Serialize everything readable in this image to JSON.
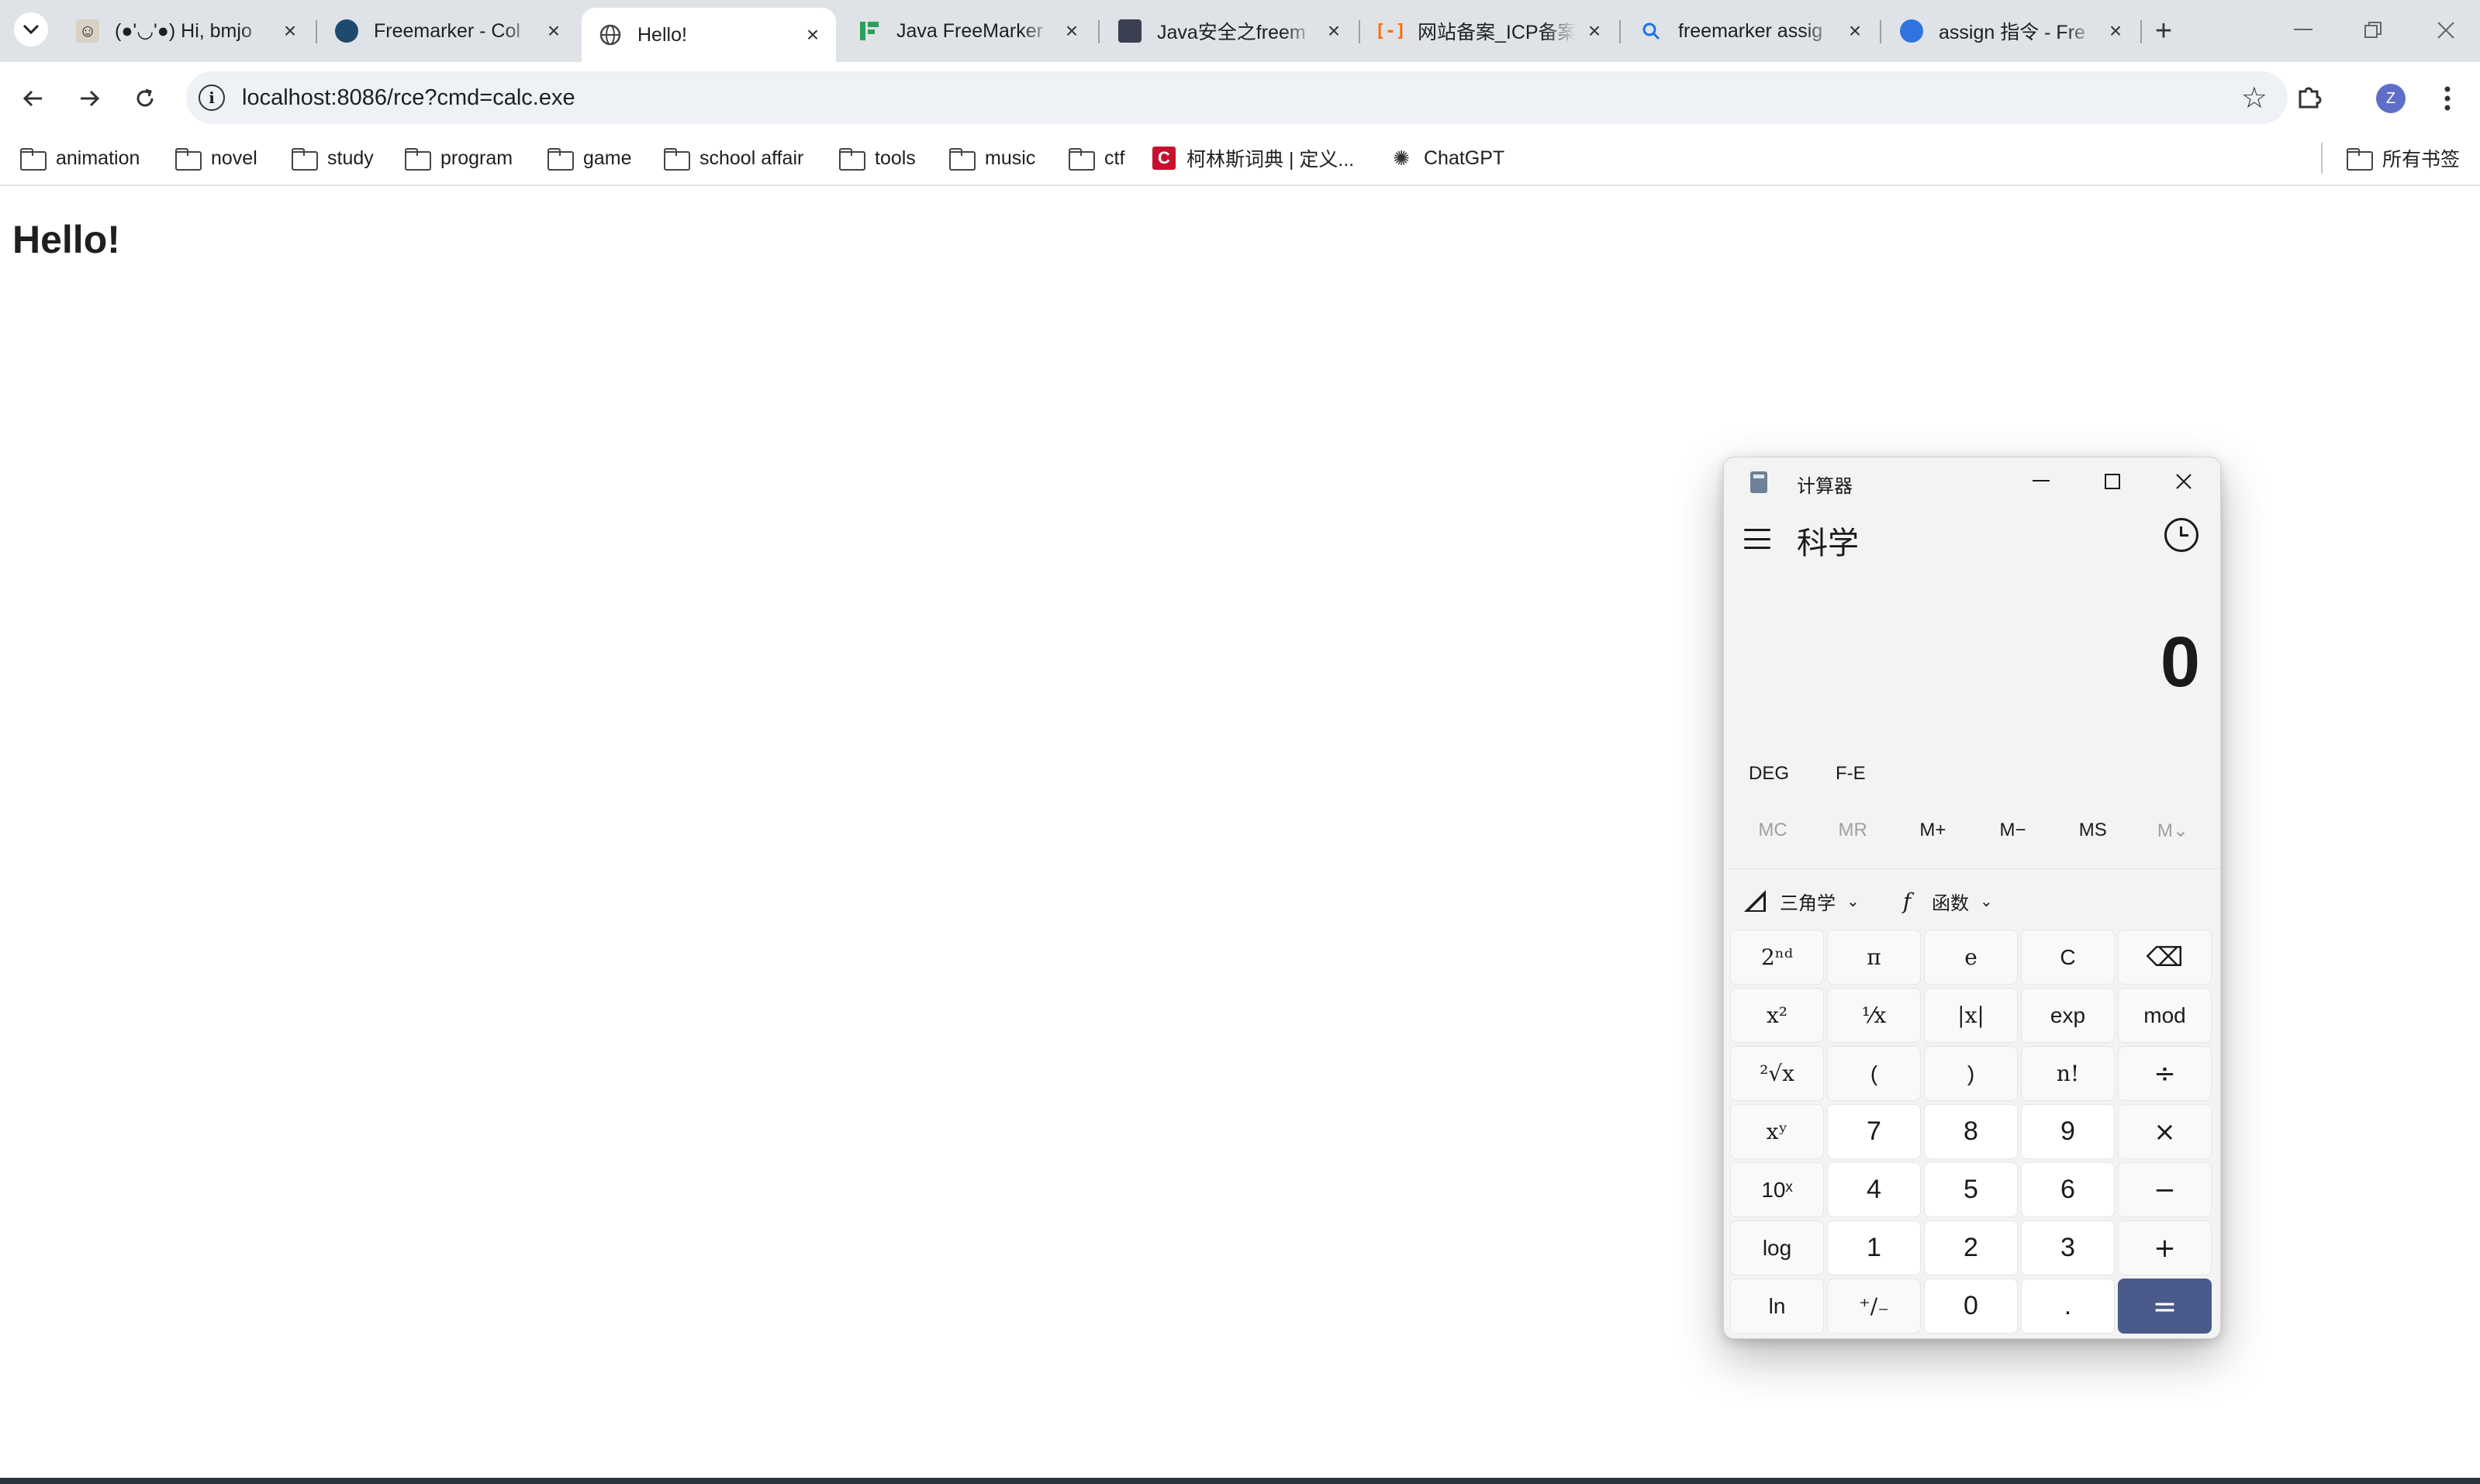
{
  "browser": {
    "tabs": [
      {
        "title": "(●'◡'●) Hi, bmjo",
        "favicon": "anime-avatar-icon"
      },
      {
        "title": "Freemarker - Col",
        "favicon": "globe-dark-icon"
      },
      {
        "title": "Hello!",
        "favicon": "globe-icon"
      },
      {
        "title": "Java FreeMarker",
        "favicon": "green-blocks-icon"
      },
      {
        "title": "Java安全之freem",
        "favicon": "avatar-icon"
      },
      {
        "title": "网站备案_ICP备案",
        "favicon": "orange-bracket-icon"
      },
      {
        "title": "freemarker assig",
        "favicon": "search-icon"
      },
      {
        "title": "assign 指令 - Fre",
        "favicon": "blue-globe-icon"
      }
    ],
    "active_tab_index": 2,
    "url": "localhost:8086/rce?cmd=calc.exe",
    "profile_initial": "Z",
    "bookmarks": [
      {
        "label": "animation",
        "type": "folder"
      },
      {
        "label": "novel",
        "type": "folder"
      },
      {
        "label": "study",
        "type": "folder"
      },
      {
        "label": "program",
        "type": "folder"
      },
      {
        "label": "game",
        "type": "folder"
      },
      {
        "label": "school affair",
        "type": "folder"
      },
      {
        "label": "tools",
        "type": "folder"
      },
      {
        "label": "music",
        "type": "folder"
      },
      {
        "label": "ctf",
        "type": "folder"
      },
      {
        "label": "柯林斯词典 | 定义...",
        "type": "link"
      },
      {
        "label": "ChatGPT",
        "type": "link"
      }
    ],
    "all_bookmarks_label": "所有书签"
  },
  "page": {
    "heading": "Hello!"
  },
  "calculator": {
    "window_title": "计算器",
    "mode": "科学",
    "display": "0",
    "angle_unit": "DEG",
    "fe_label": "F-E",
    "memory": [
      "MC",
      "MR",
      "M+",
      "M−",
      "MS",
      "M⌄"
    ],
    "trig_label": "三角学",
    "func_label": "函数",
    "keys": [
      [
        "2ⁿᵈ",
        "π",
        "e",
        "C",
        "⌫"
      ],
      [
        "x²",
        "⅟x",
        "|x|",
        "exp",
        "mod"
      ],
      [
        "²√x",
        "(",
        ")",
        "n!",
        "÷"
      ],
      [
        "xʸ",
        "7",
        "8",
        "9",
        "×"
      ],
      [
        "10ˣ",
        "4",
        "5",
        "6",
        "−"
      ],
      [
        "log",
        "1",
        "2",
        "3",
        "+"
      ],
      [
        "ln",
        "⁺∕₋",
        "0",
        ".",
        "="
      ]
    ]
  },
  "colors": {
    "tabstrip": "#dfe3e8",
    "omnibox": "#eef1f5",
    "calc_equals": "#4a5a8a",
    "profile": "#5f6ec8"
  }
}
